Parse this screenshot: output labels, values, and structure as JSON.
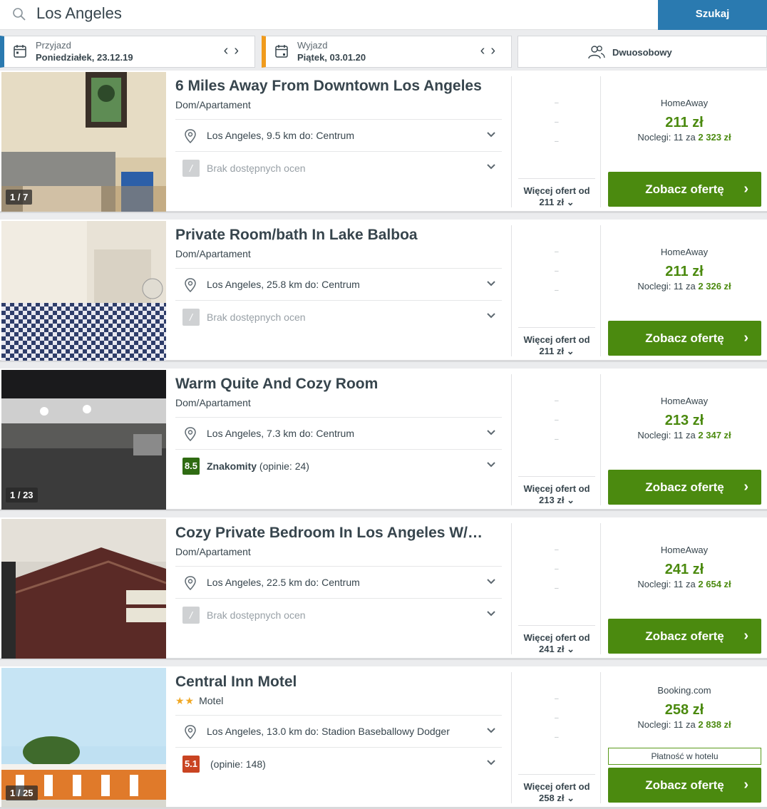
{
  "search": {
    "query": "Los Angeles",
    "button": "Szukaj"
  },
  "checkin": {
    "label": "Przyjazd",
    "value": "Poniedziałek, 23.12.19"
  },
  "checkout": {
    "label": "Wyjazd",
    "value": "Piątek, 03.01.20"
  },
  "room": {
    "label": "Dwuosobowy"
  },
  "colors": {
    "accent": "#2a7ab0",
    "checkin": "#2a7ab0",
    "checkout": "#f09b1d",
    "price_green": "#4b8a0f"
  },
  "listings": [
    {
      "title": "6 Miles Away From Downtown Los Angeles",
      "type": "Dom/Apartament",
      "location": "Los Angeles, 9.5 km do: Centrum",
      "rating_badge": "/",
      "rating_text": "Brak dostępnych ocen",
      "counter": "1 / 7",
      "more_label": "Więcej ofert od",
      "more_price": "211 zł",
      "provider": "HomeAway",
      "price": "211 zł",
      "nights_prefix": "Noclegi: 11 za",
      "nights_total": "2 323 zł",
      "cta": "Zobacz ofertę"
    },
    {
      "title": "Private Room/bath In Lake Balboa",
      "type": "Dom/Apartament",
      "location": "Los Angeles, 25.8 km do: Centrum",
      "rating_badge": "/",
      "rating_text": "Brak dostępnych ocen",
      "counter": "",
      "more_label": "Więcej ofert od",
      "more_price": "211 zł",
      "provider": "HomeAway",
      "price": "211 zł",
      "nights_prefix": "Noclegi: 11 za",
      "nights_total": "2 326 zł",
      "cta": "Zobacz ofertę"
    },
    {
      "title": "Warm Quite And Cozy Room",
      "type": "Dom/Apartament",
      "location": "Los Angeles, 7.3 km do: Centrum",
      "rating_badge": "8.5",
      "rating_label": "Znakomity",
      "rating_count": "(opinie: 24)",
      "counter": "1 / 23",
      "more_label": "Więcej ofert od",
      "more_price": "213 zł",
      "provider": "HomeAway",
      "price": "213 zł",
      "nights_prefix": "Noclegi: 11 za",
      "nights_total": "2 347 zł",
      "cta": "Zobacz ofertę"
    },
    {
      "title": "Cozy Private Bedroom In Los Angeles W/…",
      "type": "Dom/Apartament",
      "location": "Los Angeles, 22.5 km do: Centrum",
      "rating_badge": "/",
      "rating_text": "Brak dostępnych ocen",
      "counter": "",
      "more_label": "Więcej ofert od",
      "more_price": "241 zł",
      "provider": "HomeAway",
      "price": "241 zł",
      "nights_prefix": "Noclegi: 11 za",
      "nights_total": "2 654 zł",
      "cta": "Zobacz ofertę"
    },
    {
      "title": "Central Inn Motel",
      "stars": "★★",
      "type": "Motel",
      "location": "Los Angeles, 13.0 km do: Stadion Baseballowy Dodger",
      "rating_badge": "5.1",
      "rating_count": "(opinie: 148)",
      "counter": "1 / 25",
      "more_label": "Więcej ofert od",
      "more_price": "258 zł",
      "provider": "Booking.com",
      "price": "258 zł",
      "nights_prefix": "Noclegi: 11 za",
      "nights_total": "2 838 zł",
      "pay_badge": "Płatność w hotelu",
      "cta": "Zobacz ofertę"
    }
  ]
}
